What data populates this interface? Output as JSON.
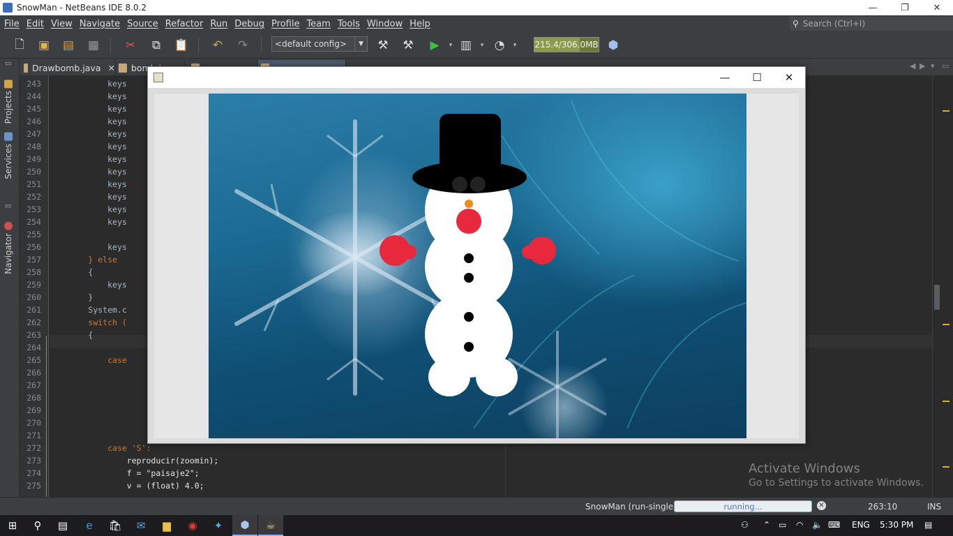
{
  "window": {
    "title": "SnowMan - NetBeans IDE 8.0.2",
    "controls": [
      "—",
      "❐",
      "✕"
    ]
  },
  "menu": {
    "items": [
      "File",
      "Edit",
      "View",
      "Navigate",
      "Source",
      "Refactor",
      "Run",
      "Debug",
      "Profile",
      "Team",
      "Tools",
      "Window",
      "Help"
    ]
  },
  "search": {
    "placeholder": "Search (Ctrl+I)",
    "icon": "search-icon"
  },
  "toolbar": {
    "config": "<default config>",
    "memory": "215.4/306.0MB",
    "memory_used_fraction": 0.704
  },
  "sidebar": {
    "tabs": [
      "Projects",
      "Services",
      "Navigator"
    ]
  },
  "tabs": [
    {
      "label": "Drawbomb.java"
    },
    {
      "label": "bomb.java"
    },
    {
      "label": ""
    },
    {
      "label": ""
    }
  ],
  "editor": {
    "line_numbers": [
      "243",
      "244",
      "245",
      "246",
      "247",
      "248",
      "249",
      "250",
      "251",
      "252",
      "253",
      "254",
      "255",
      "256",
      "257",
      "258",
      "259",
      "260",
      "261",
      "262",
      "263",
      "264",
      "265",
      "266",
      "267",
      "268",
      "269",
      "270",
      "271",
      "272",
      "273",
      "274",
      "275"
    ],
    "lines": [
      {
        "indent": "            ",
        "text": "keys"
      },
      {
        "indent": "            ",
        "text": "keys"
      },
      {
        "indent": "            ",
        "text": "keys"
      },
      {
        "indent": "            ",
        "text": "keys"
      },
      {
        "indent": "            ",
        "text": "keys"
      },
      {
        "indent": "            ",
        "text": "keys"
      },
      {
        "indent": "            ",
        "text": "keys"
      },
      {
        "indent": "            ",
        "text": "keys"
      },
      {
        "indent": "            ",
        "text": "keys"
      },
      {
        "indent": "            ",
        "text": "keys"
      },
      {
        "indent": "            ",
        "text": "keys"
      },
      {
        "indent": "            ",
        "text": "keys"
      },
      {
        "indent": "",
        "text": ""
      },
      {
        "indent": "            ",
        "text": "keys"
      },
      {
        "indent": "        ",
        "text": "} else"
      },
      {
        "indent": "        ",
        "text": "{"
      },
      {
        "indent": "            ",
        "text": "keys"
      },
      {
        "indent": "        ",
        "text": "}"
      },
      {
        "indent": "        ",
        "text": "System.c"
      },
      {
        "indent": "        ",
        "text": "switch ("
      },
      {
        "indent": "        ",
        "text": "{"
      },
      {
        "indent": "",
        "text": ""
      },
      {
        "indent": "            ",
        "text": "case"
      },
      {
        "indent": "",
        "text": ""
      },
      {
        "indent": "",
        "text": ""
      },
      {
        "indent": "",
        "text": ""
      },
      {
        "indent": "",
        "text": ""
      },
      {
        "indent": "",
        "text": ""
      },
      {
        "indent": "",
        "text": ""
      },
      {
        "indent": "            ",
        "text": "case 'S':"
      },
      {
        "indent": "                ",
        "text": "reproducir(zoomin);"
      },
      {
        "indent": "                ",
        "text": "f = \"paisaje2\";"
      },
      {
        "indent": "                ",
        "text": "v = (float) 4.0;"
      }
    ]
  },
  "jframe": {
    "title": "",
    "controls": [
      "—",
      "☐",
      "✕"
    ]
  },
  "status": {
    "run_label": "SnowMan (run-single)",
    "progress_text": "running...",
    "caret": "263:10",
    "mode": "INS"
  },
  "watermark": {
    "line1": "Activate Windows",
    "line2": "Go to Settings to activate Windows."
  },
  "taskbar": {
    "lang": "ENG",
    "time": "5:30 PM"
  }
}
